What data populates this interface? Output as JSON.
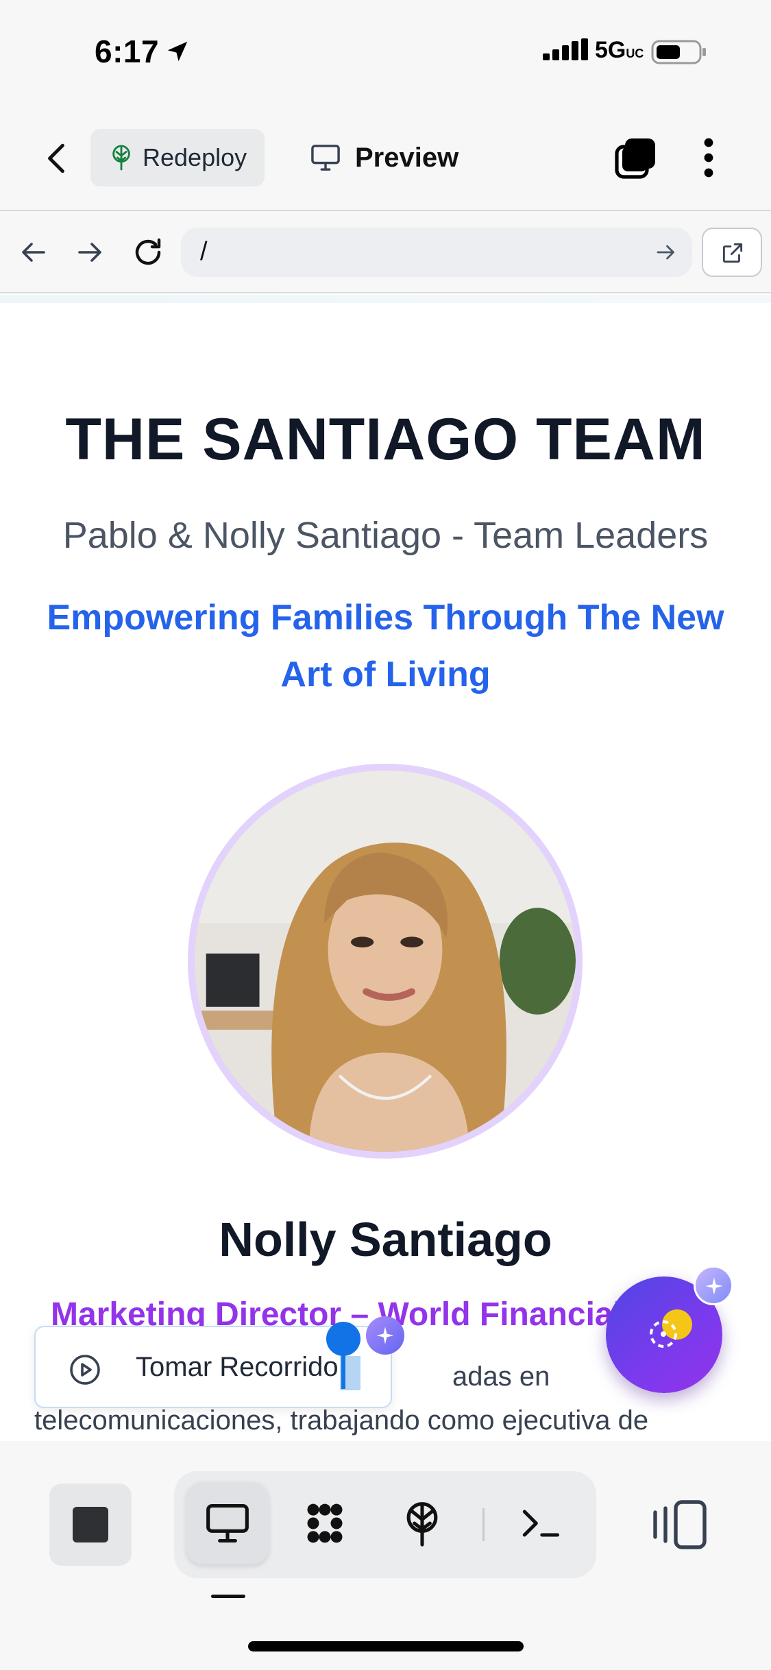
{
  "status_bar": {
    "time": "6:17",
    "network": "5G",
    "network_suffix": "UC"
  },
  "toolbar": {
    "redeploy_label": "Redeploy",
    "preview_label": "Preview"
  },
  "url_bar": {
    "url": "/"
  },
  "page": {
    "title": "THE SANTIAGO TEAM",
    "subtitle": "Pablo & Nolly Santiago - Team Leaders",
    "tagline": "Empowering Families Through The New Art of Living",
    "member": {
      "name": "Nolly Santiago",
      "role": "Marketing Director – World Financial",
      "bio_line_1": "adas en",
      "bio_line_2": "telecomunicaciones, trabajando como ejecutiva de"
    }
  },
  "tour": {
    "label": "Tomar Recorrido"
  },
  "colors": {
    "accent_blue": "#2563eb",
    "role_purple": "#9333ea",
    "avatar_ring": "#e3d2fb",
    "fab_gradient_start": "#4f46e5",
    "fab_gradient_end": "#9333ea"
  },
  "bottom_bar": {
    "modes": [
      {
        "icon": "monitor-icon",
        "active": true
      },
      {
        "icon": "integrations-icon",
        "active": false
      },
      {
        "icon": "deploy-icon",
        "active": false
      },
      {
        "icon": "terminal-icon",
        "active": false
      }
    ]
  }
}
